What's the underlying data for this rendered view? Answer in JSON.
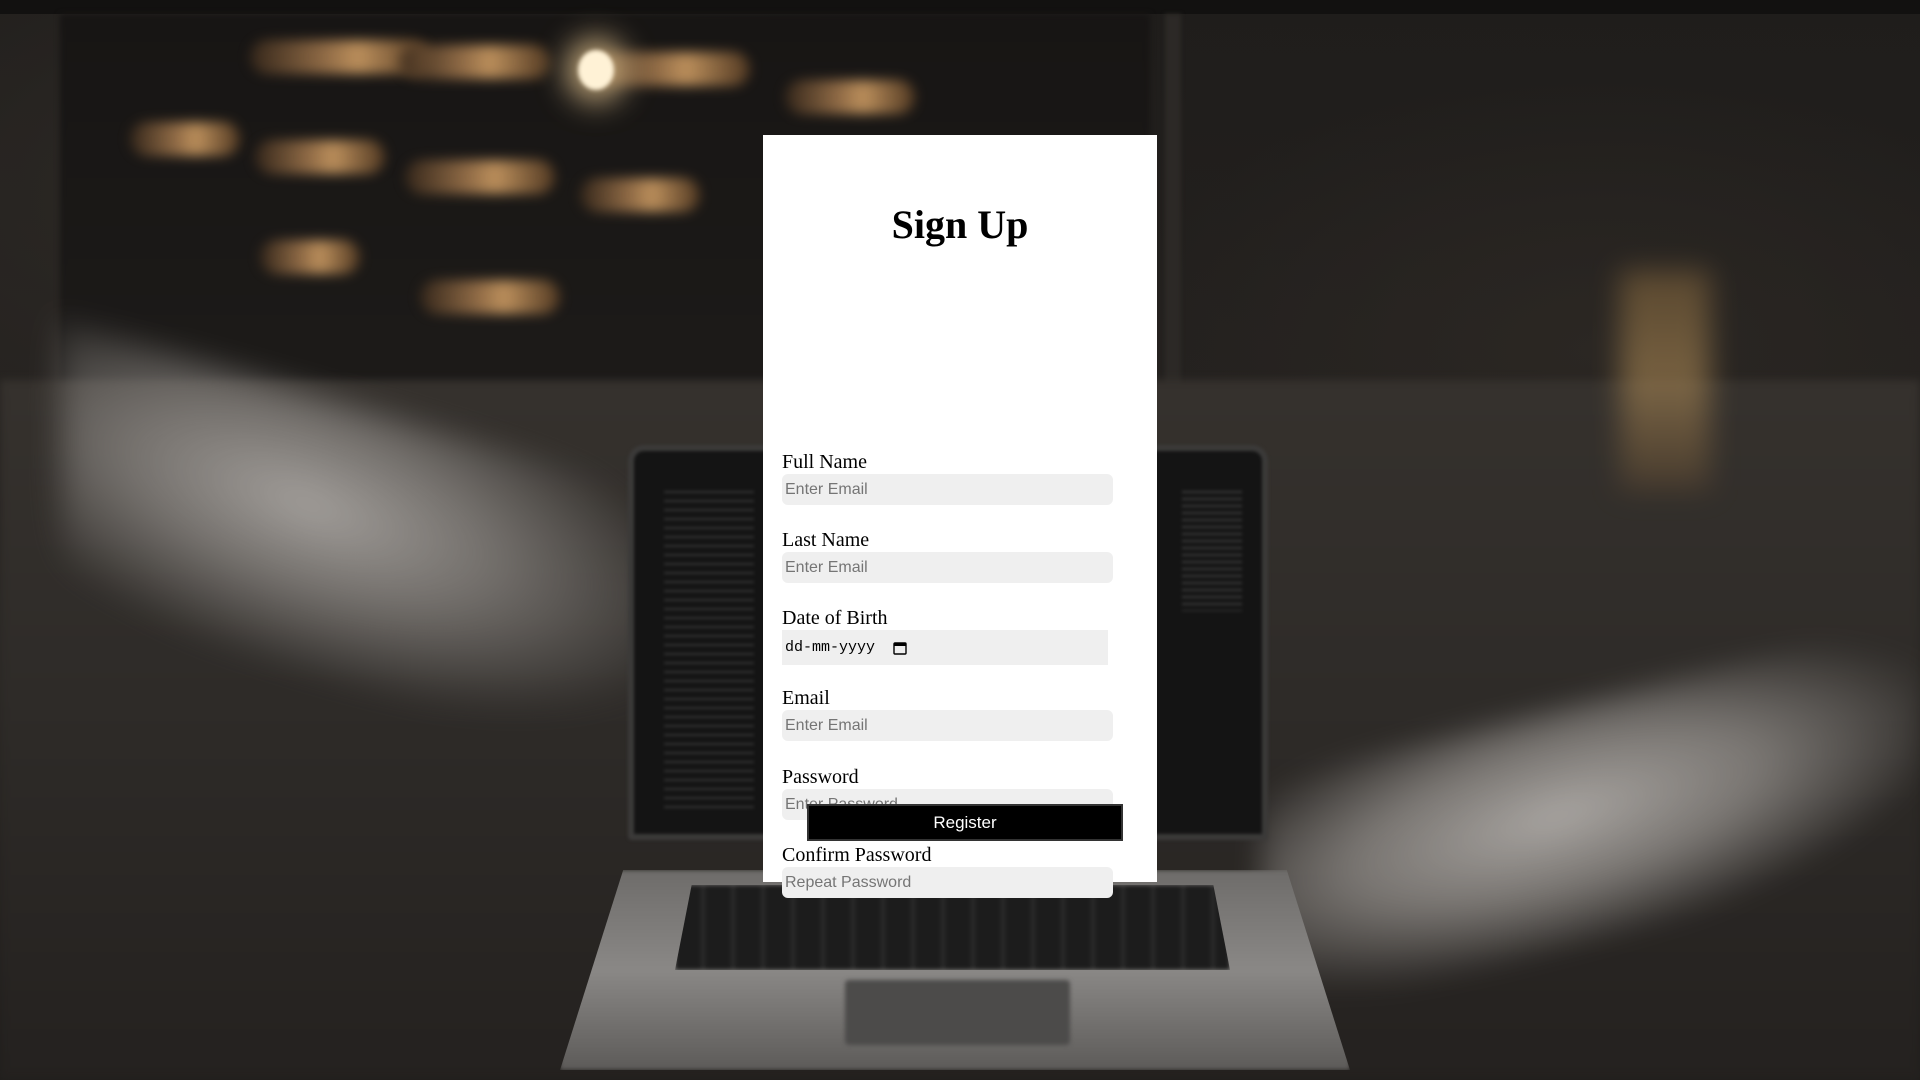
{
  "form": {
    "title": "Sign Up",
    "fields": [
      {
        "label": "Full Name",
        "placeholder": "Enter Email"
      },
      {
        "label": "Last Name",
        "placeholder": "Enter Email"
      },
      {
        "label": "Date of Birth",
        "value": "dd-mm-yyyy"
      },
      {
        "label": "Email",
        "placeholder": "Enter Email"
      },
      {
        "label": "Password",
        "placeholder": "Enter Password"
      },
      {
        "label": "Confirm Password",
        "placeholder": "Repeat Password"
      }
    ],
    "submit_label": "Register"
  }
}
